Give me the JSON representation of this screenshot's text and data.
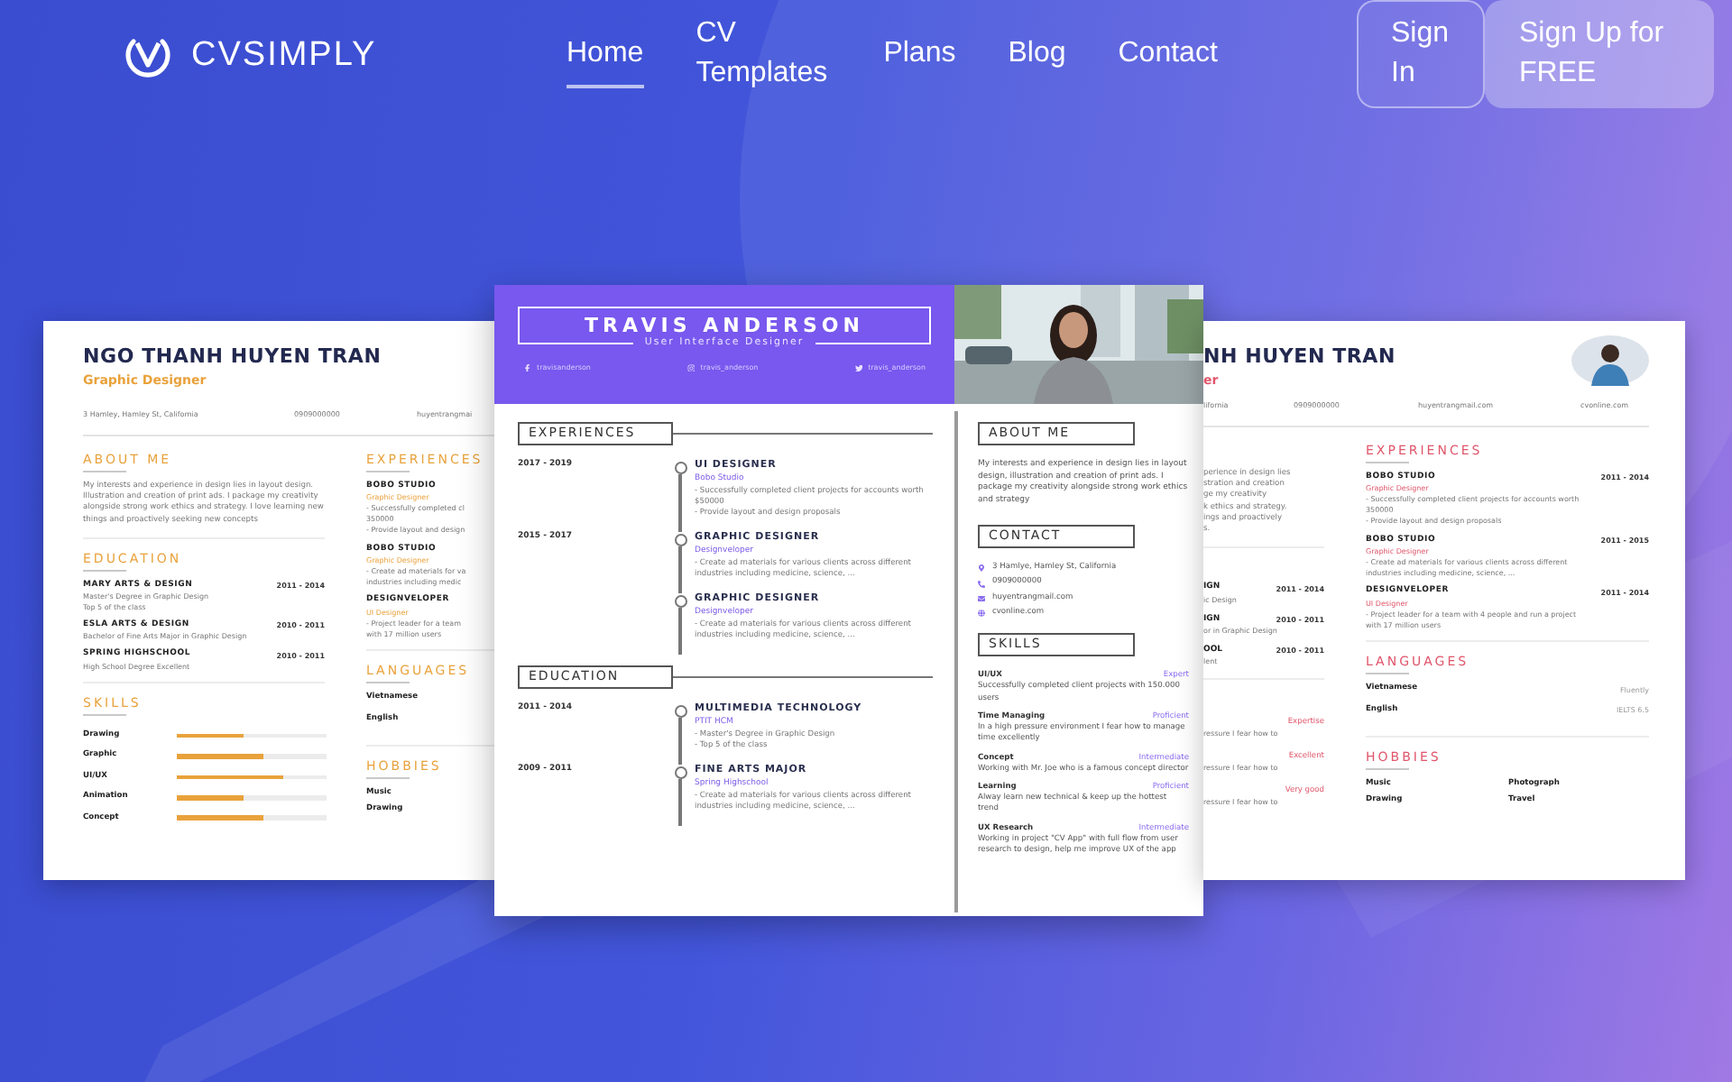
{
  "header": {
    "logo": "CVSIMPLY",
    "nav": [
      {
        "label": "Home",
        "selected": true
      },
      {
        "label": "CV Templates",
        "selected": false
      },
      {
        "label": "Plans",
        "selected": false
      },
      {
        "label": "Blog",
        "selected": false
      },
      {
        "label": "Contact",
        "selected": false
      }
    ],
    "sign_in": "Sign In",
    "sign_up": "Sign Up for FREE"
  },
  "left_resume": {
    "name": "NGO THANH HUYEN TRAN",
    "role": "Graphic Designer",
    "contacts": [
      "3 Hamley, Hamley St, California",
      "0909000000",
      "huyentrangmai"
    ],
    "about": {
      "title": "ABOUT ME",
      "text": "My interests and experience in design lies in layout design. Illustration and creation of print ads. I package my creativity alongside strong work ethics and strategy. I love learning new things and proactively seeking new concepts"
    },
    "education": {
      "title": "EDUCATION",
      "items": [
        {
          "name": "MARY ARTS & DESIGN",
          "date": "2011 - 2014",
          "details": [
            "Master's Degree in Graphic Design",
            "Top 5 of the class"
          ]
        },
        {
          "name": "ESLA ARTS & DESIGN",
          "date": "2010 - 2011",
          "details": [
            "Bachelor of Fine Arts Major in Graphic Design"
          ]
        },
        {
          "name": "SPRING HIGHSCHOOL",
          "date": "2010 - 2011",
          "details": [
            "High School Degree Excellent"
          ]
        }
      ]
    },
    "skills": {
      "title": "SKILLS",
      "items": [
        {
          "name": "Drawing",
          "level": 0.44
        },
        {
          "name": "Graphic",
          "level": 0.58
        },
        {
          "name": "UI/UX",
          "level": 0.71
        },
        {
          "name": "Animation",
          "level": 0.44
        },
        {
          "name": "Concept",
          "level": 0.58
        }
      ]
    },
    "experiences": {
      "title": "EXPERIENCES",
      "items": [
        {
          "company": "BOBO STUDIO",
          "role": "Graphic Designer",
          "lines": [
            "- Successfully completed cl",
            "350000",
            "- Provide layout and design"
          ]
        },
        {
          "company": "BOBO STUDIO",
          "role": "Graphic Designer",
          "lines": [
            "- Create ad materials for va",
            "industries including medic"
          ]
        },
        {
          "company": "DESIGNVELOPER",
          "role": "UI Designer",
          "lines": [
            "- Project leader for a team",
            "with 17 million users"
          ]
        }
      ]
    },
    "languages": {
      "title": "LANGUAGES",
      "items": [
        "Vietnamese",
        "English"
      ]
    },
    "hobbies": {
      "title": "HOBBIES",
      "items": [
        "Music",
        "Drawing"
      ]
    }
  },
  "center_resume": {
    "name": "TRAVIS ANDERSON",
    "role": "User Interface Designer",
    "socials": [
      {
        "kind": "facebook",
        "handle": "travisanderson"
      },
      {
        "kind": "instagram",
        "handle": "travis_anderson"
      },
      {
        "kind": "twitter",
        "handle": "travis_anderson"
      }
    ],
    "photo": {
      "kind": "picture"
    },
    "experiences": {
      "title": "EXPERIENCES",
      "items": [
        {
          "date": "2017 - 2019",
          "title": "UI DESIGNER",
          "org": "Bobo Studio",
          "lines": [
            "- Successfully completed client projects for accounts worth $50000",
            "- Provide layout and design proposals"
          ]
        },
        {
          "date": "2015 - 2017",
          "title": "GRAPHIC DESIGNER",
          "org": "Designveloper",
          "lines": [
            "- Create ad materials for various clients across different industries including medicine, science, ..."
          ]
        },
        {
          "title": "GRAPHIC DESIGNER",
          "org": "Designveloper",
          "lines": [
            "- Create ad materials for various clients across different industries including medicine, science, ..."
          ]
        }
      ]
    },
    "education": {
      "title": "EDUCATION",
      "items": [
        {
          "date": "2011 - 2014",
          "title": "MULTIMEDIA TECHNOLOGY",
          "org": "PTIT HCM",
          "lines": [
            "- Master's Degree in Graphic Design",
            "- Top 5 of the class"
          ]
        },
        {
          "date": "2009 - 2011",
          "title": "FINE ARTS MAJOR",
          "org": "Spring Highschool",
          "lines": [
            "- Create ad materials for various clients across different industries including medicine, science, ..."
          ]
        }
      ]
    },
    "about": {
      "title": "ABOUT ME",
      "text": "My interests and experience in design lies in layout design, illustration and creation of print ads. I package my creativity alongside strong work ethics and strategy"
    },
    "contact": {
      "title": "CONTACT",
      "items": [
        {
          "kind": "address",
          "text": "3 Hamlye, Hamley St, California"
        },
        {
          "kind": "phone",
          "text": "0909000000"
        },
        {
          "kind": "email",
          "text": "huyentrangmail.com"
        },
        {
          "kind": "web",
          "text": "cvonline.com"
        }
      ]
    },
    "skills": {
      "title": "SKILLS",
      "items": [
        {
          "name": "UI/UX",
          "rating": "Expert",
          "text": "Successfully completed client projects with 150.000 users"
        },
        {
          "name": "Time Managing",
          "rating": "Proficient",
          "text": "In a high pressure environment I fear how to manage time excellently"
        },
        {
          "name": "Concept",
          "rating": "Intermediate",
          "text": "Working with Mr. Joe who is a famous concept director"
        },
        {
          "name": "Learning",
          "rating": "Proficient",
          "text": "Alway learn new technical & keep up the hottest trend"
        },
        {
          "name": "UX Research",
          "rating": "Intermediate",
          "text": "Working in project \"CV App\" with full flow from user research to design, help me improve UX of the app"
        }
      ]
    }
  },
  "right_resume": {
    "name": "NH HUYEN TRAN",
    "role": "er",
    "avatar": {
      "kind": "picture"
    },
    "contacts": [
      "lifornia",
      "0909000000",
      "huyentrangmail.com",
      "cvonline.com"
    ],
    "about_lines": [
      "perience in design lies",
      "stration and creation",
      "ge my creativity",
      "k ethics and strategy.",
      "ings and proactively",
      "s."
    ],
    "education": [
      {
        "name": "IGN",
        "date": "2011 - 2014",
        "detail": "ic Design"
      },
      {
        "name": "IGN",
        "date": "2010 - 2011",
        "detail": "or in Graphic Design"
      },
      {
        "name": "OOL",
        "date": "2010 - 2011",
        "detail": "lent"
      }
    ],
    "skills": [
      {
        "rating": "Expertise",
        "detail": "ressure I fear how to"
      },
      {
        "rating": "Excellent",
        "detail": "ressure I fear how to"
      },
      {
        "rating": "Very good",
        "detail": "ressure I fear how to"
      }
    ],
    "experiences": {
      "title": "EXPERIENCES",
      "items": [
        {
          "company": "BOBO STUDIO",
          "date": "2011 - 2014",
          "role": "Graphic Designer",
          "lines": [
            "- Successfully completed client projects for accounts worth",
            "350000",
            "- Provide layout and design proposals"
          ]
        },
        {
          "company": "BOBO STUDIO",
          "date": "2011 - 2015",
          "role": "Graphic Designer",
          "lines": [
            "- Create ad materials for various clients across different",
            "industries including medicine, science, ..."
          ]
        },
        {
          "company": "DESIGNVELOPER",
          "date": "2011 - 2014",
          "role": "UI Designer",
          "lines": [
            "- Project leader for a team with 4 people and run a project",
            "with 17 million users"
          ]
        }
      ]
    },
    "languages": {
      "title": "LANGUAGES",
      "items": [
        {
          "name": "Vietnamese",
          "value": "Fluently"
        },
        {
          "name": "English",
          "value": "IELTS 6.5"
        }
      ]
    },
    "hobbies": {
      "title": "HOBBIES",
      "items": [
        "Music",
        "Photograph",
        "Drawing",
        "Travel"
      ]
    }
  }
}
